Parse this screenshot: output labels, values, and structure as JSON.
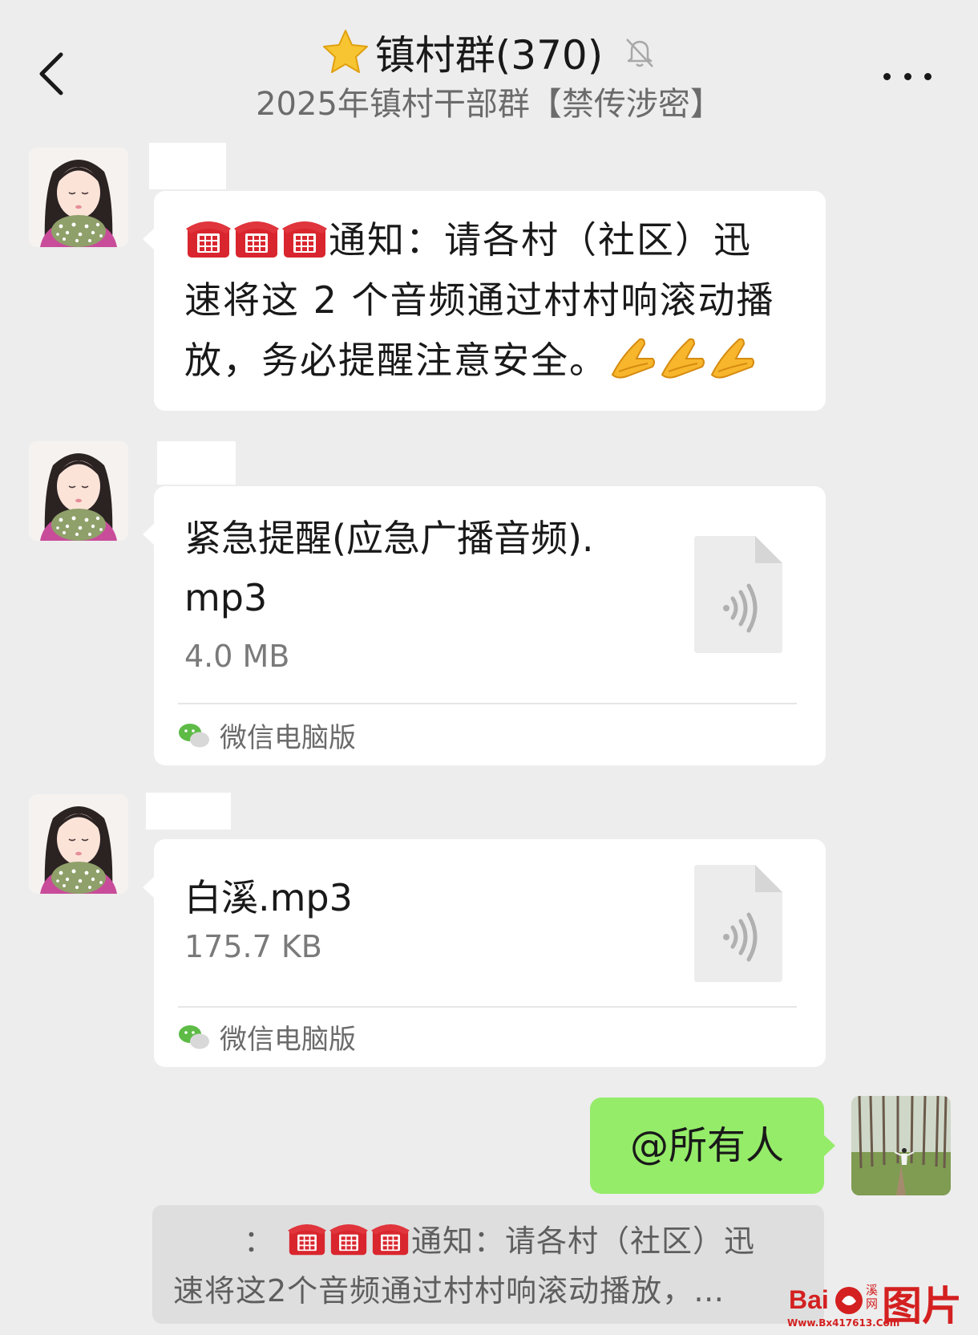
{
  "header": {
    "title": "镇村群(370)",
    "subtitle": "2025年镇村干部群【禁传涉密】"
  },
  "messages": [
    {
      "type": "text",
      "line1": "通知：请各村（社区）迅",
      "line2": "速将这 2 个音频通过村村响滚动播",
      "line3": "放，务必提醒注意安全。"
    },
    {
      "type": "file",
      "name_line1": "紧急提醒(应急广播音频).",
      "name_line2": "mp3",
      "size": "4.0 MB",
      "source": "微信电脑版"
    },
    {
      "type": "file",
      "name_line1": "白溪.mp3",
      "size": "175.7 KB",
      "source": "微信电脑版"
    },
    {
      "type": "text-self",
      "text": "@所有人"
    }
  ],
  "quote": {
    "prefix": "：",
    "line1": "通知：请各村（社区）迅",
    "line2": "速将这2个音频通过村村响滚动播放，…"
  },
  "watermark": {
    "brand": "Bai",
    "url": "Www.Bx417613.Com",
    "label": "图片",
    "side": "溪网"
  },
  "colors": {
    "background": "#ededed",
    "bubble": "#ffffff",
    "self_bubble": "#95ec69",
    "quote_bg": "#dedede"
  }
}
